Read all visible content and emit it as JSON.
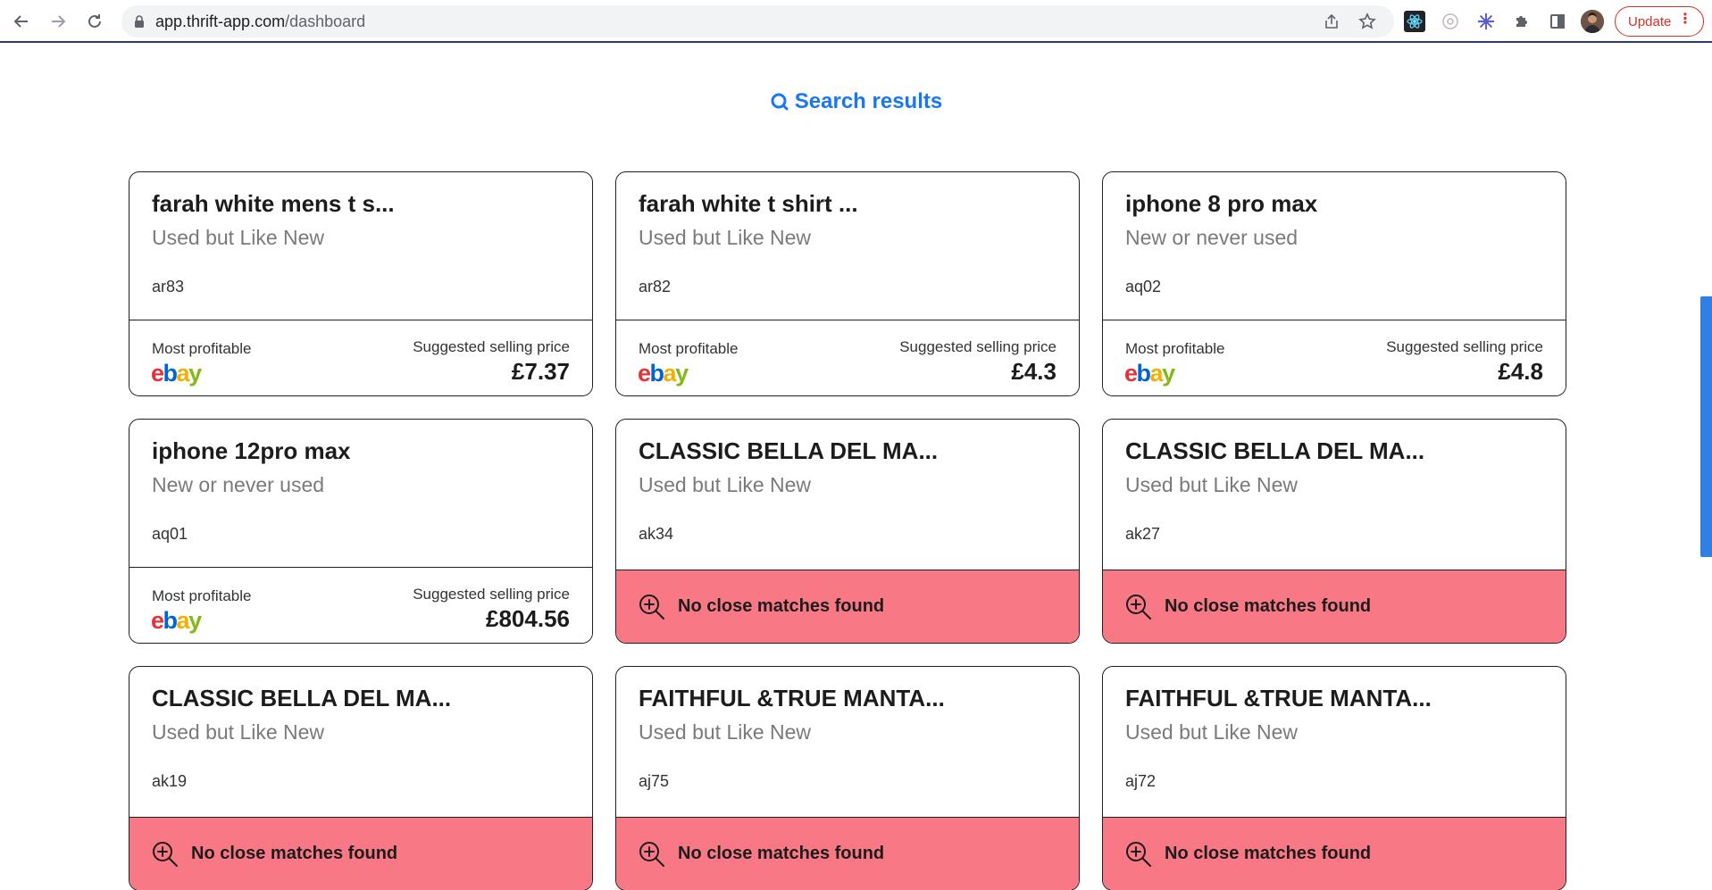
{
  "browser": {
    "url_host": "app.thrift-app.com",
    "url_path": "/dashboard",
    "update_label": "Update",
    "icons": [
      "back-arrow-icon",
      "forward-arrow-icon",
      "reload-icon",
      "lock-icon",
      "share-icon",
      "star-icon",
      "react-devtools-icon",
      "circle-extension-icon",
      "flower-extension-icon",
      "puzzle-extensions-icon",
      "side-panel-icon",
      "profile-avatar",
      "more-vert-icon"
    ]
  },
  "heading": {
    "label": "Search results",
    "icon": "search-icon",
    "color": "#1877f2"
  },
  "colors": {
    "no_match_bg": "#f87985",
    "ebay": [
      "#e53238",
      "#0064d2",
      "#f5af02",
      "#86b817"
    ],
    "scroll_indicator": "#2f7fe4"
  },
  "labels": {
    "most_profitable": "Most profitable",
    "suggested_price": "Suggested selling price",
    "no_match": "No close matches found",
    "ebay_letters": [
      "e",
      "b",
      "a",
      "y"
    ]
  },
  "cards": [
    {
      "title": "farah white mens t s...",
      "condition": "Used but Like New",
      "sku": "ar83",
      "status": "match",
      "price": "£7.37"
    },
    {
      "title": "farah white t shirt ...",
      "condition": "Used but Like New",
      "sku": "ar82",
      "status": "match",
      "price": "£4.3"
    },
    {
      "title": "iphone 8 pro max",
      "condition": "New or never used",
      "sku": "aq02",
      "status": "match",
      "price": "£4.8"
    },
    {
      "title": "iphone 12pro max",
      "condition": "New or never used",
      "sku": "aq01",
      "status": "match",
      "price": "£804.56"
    },
    {
      "title": "CLASSIC BELLA DEL MA...",
      "condition": "Used but Like New",
      "sku": "ak34",
      "status": "no-match",
      "price": ""
    },
    {
      "title": "CLASSIC BELLA DEL MA...",
      "condition": "Used but Like New",
      "sku": "ak27",
      "status": "no-match",
      "price": ""
    },
    {
      "title": "CLASSIC BELLA DEL MA...",
      "condition": "Used but Like New",
      "sku": "ak19",
      "status": "no-match",
      "price": ""
    },
    {
      "title": "FAITHFUL &TRUE MANTA...",
      "condition": "Used but Like New",
      "sku": "aj75",
      "status": "no-match",
      "price": ""
    },
    {
      "title": "FAITHFUL &TRUE MANTA...",
      "condition": "Used but Like New",
      "sku": "aj72",
      "status": "no-match",
      "price": ""
    }
  ]
}
